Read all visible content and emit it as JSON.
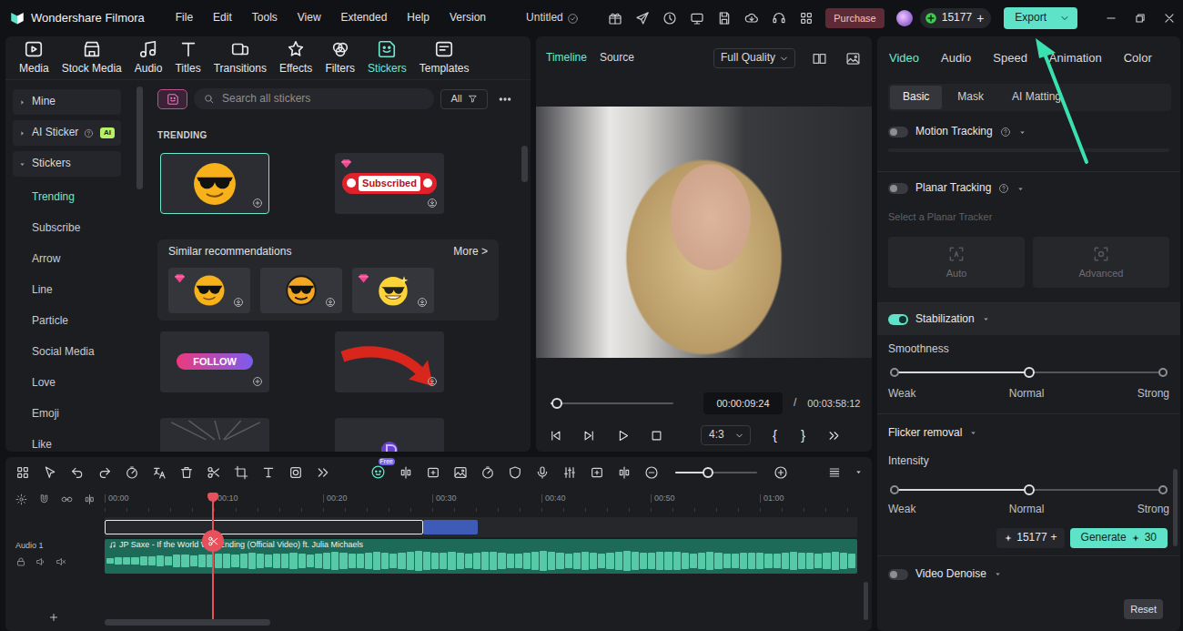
{
  "app": {
    "title": "Wondershare Filmora",
    "menu": [
      "File",
      "Edit",
      "Tools",
      "View",
      "Extended",
      "Help",
      "Version"
    ],
    "project": "Untitled",
    "purchase": "Purchase",
    "credits": "15177",
    "credits_add": "+",
    "export": "Export"
  },
  "media_tabs": [
    {
      "label": "Media",
      "selected": false
    },
    {
      "label": "Stock Media",
      "selected": false
    },
    {
      "label": "Audio",
      "selected": false
    },
    {
      "label": "Titles",
      "selected": false
    },
    {
      "label": "Transitions",
      "selected": false
    },
    {
      "label": "Effects",
      "selected": false
    },
    {
      "label": "Filters",
      "selected": false
    },
    {
      "label": "Stickers",
      "selected": true
    },
    {
      "label": "Templates",
      "selected": false
    }
  ],
  "sidebar": {
    "groups": [
      {
        "label": "Mine",
        "expanded": false
      },
      {
        "label": "AI Sticker",
        "expanded": false,
        "badge": "AI"
      },
      {
        "label": "Stickers",
        "expanded": true,
        "items": [
          {
            "label": "Trending",
            "selected": true
          },
          {
            "label": "Subscribe",
            "selected": false
          },
          {
            "label": "Arrow",
            "selected": false
          },
          {
            "label": "Line",
            "selected": false
          },
          {
            "label": "Particle",
            "selected": false
          },
          {
            "label": "Social Media",
            "selected": false
          },
          {
            "label": "Love",
            "selected": false
          },
          {
            "label": "Emoji",
            "selected": false
          },
          {
            "label": "Like",
            "selected": false
          }
        ]
      }
    ]
  },
  "library": {
    "search": {
      "placeholder": "Search all stickers"
    },
    "filter": "All",
    "section": "TRENDING",
    "trending": [
      {
        "kind": "cool-emoji",
        "premium": false,
        "downloaded": true,
        "selected": true
      },
      {
        "kind": "subscribed",
        "text": "Subscribed",
        "premium": true,
        "downloaded": false,
        "selected": false
      }
    ],
    "similar": {
      "title": "Similar recommendations",
      "more": "More >",
      "items": [
        {
          "kind": "cool-emoji",
          "premium": true,
          "downloaded": false,
          "selected": false
        },
        {
          "kind": "cool-emoji-dark",
          "premium": false,
          "downloaded": false,
          "selected": false
        },
        {
          "kind": "grin-emoji",
          "premium": true,
          "downloaded": false,
          "selected": false
        }
      ]
    },
    "more_items": [
      {
        "kind": "follow",
        "text": "FOLLOW",
        "premium": false,
        "downloaded": true,
        "selected": false
      },
      {
        "kind": "red-arrow",
        "premium": false,
        "downloaded": false,
        "selected": false
      },
      {
        "kind": "rays",
        "premium": false,
        "downloaded": false,
        "selected": false
      },
      {
        "kind": "purple",
        "premium": false,
        "downloaded": false,
        "selected": false
      }
    ]
  },
  "preview": {
    "tabs": [
      {
        "label": "Timeline",
        "selected": true
      },
      {
        "label": "Source",
        "selected": false
      }
    ],
    "quality": "Full Quality",
    "scrub": {
      "level": 0.05
    },
    "current_time": "00:00:09:24",
    "separator": "/",
    "total_time": "00:03:58:12",
    "aspect": "4:3",
    "mark_in": "{",
    "mark_out": "}"
  },
  "properties": {
    "tabs": [
      {
        "label": "Video",
        "selected": true
      },
      {
        "label": "Audio",
        "selected": false
      },
      {
        "label": "Speed",
        "selected": false
      },
      {
        "label": "Animation",
        "selected": false
      },
      {
        "label": "Color",
        "selected": false
      }
    ],
    "subtabs": [
      {
        "label": "Basic",
        "selected": true
      },
      {
        "label": "Mask",
        "selected": false
      },
      {
        "label": "AI Matting",
        "selected": false
      }
    ],
    "motion_tracking": {
      "label": "Motion Tracking",
      "on": false
    },
    "planar_tracking": {
      "label": "Planar Tracking",
      "on": false,
      "hint": "Select a Planar Tracker",
      "options": [
        {
          "label": "Auto",
          "disabled": true
        },
        {
          "label": "Advanced",
          "disabled": true
        }
      ]
    },
    "stabilization": {
      "label": "Stabilization",
      "on": true,
      "slider_label": "Smoothness",
      "level": 0.5,
      "ticks": [
        "Weak",
        "Normal",
        "Strong"
      ]
    },
    "flicker_removal": {
      "label": "Flicker removal",
      "slider_label": "Intensity",
      "level": 0.5,
      "ticks": [
        "Weak",
        "Normal",
        "Strong"
      ],
      "credits": "15177",
      "credits_add": "+",
      "generate": "Generate",
      "cost": "30"
    },
    "video_denoise": {
      "label": "Video Denoise",
      "on": false
    },
    "reset": "Reset"
  },
  "timeline": {
    "free_badge": "Free",
    "zoom": {
      "level": 0.4
    },
    "ruler": [
      "00:00",
      "00:10",
      "00:20",
      "00:30",
      "00:40",
      "00:50",
      "01:00"
    ],
    "playhead": {
      "level": 0.144
    },
    "video_clips": [
      {
        "start": 0,
        "end": 0.423,
        "selected": true,
        "color": "#26272b"
      },
      {
        "start": 0.423,
        "end": 0.496,
        "selected": false,
        "color": "#3f5bb8"
      }
    ],
    "audio_track": {
      "label": "Audio 1",
      "clip": "JP Saxe - If the World Was Ending (Official Video) ft. Julia Michaels",
      "waveform": [
        0.25,
        0.3,
        0.35,
        0.3,
        0.4,
        0.45,
        0.5,
        0.42,
        0.55,
        0.6,
        0.5,
        0.62,
        0.58,
        0.7,
        0.65,
        0.6,
        0.68,
        0.72,
        0.66,
        0.6,
        0.64,
        0.7,
        0.75,
        0.68,
        0.62,
        0.7,
        0.74,
        0.8,
        0.72,
        0.66,
        0.7,
        0.78,
        0.85,
        0.76,
        0.7,
        0.74,
        0.82,
        0.9,
        0.8,
        0.72,
        0.76,
        0.84,
        0.78,
        0.7,
        0.74,
        0.8,
        0.86,
        0.78,
        0.7,
        0.66,
        0.72,
        0.8,
        0.88,
        0.82,
        0.74,
        0.7,
        0.78,
        0.84,
        0.76,
        0.7,
        0.74,
        0.82,
        0.9,
        0.84,
        0.76,
        0.72,
        0.8,
        0.86,
        0.8,
        0.72,
        0.68,
        0.74,
        0.8,
        0.76,
        0.7,
        0.66,
        0.72,
        0.78,
        0.74,
        0.68,
        0.7,
        0.76,
        0.82,
        0.78,
        0.72,
        0.68,
        0.74,
        0.8,
        0.76,
        0.7
      ]
    }
  }
}
